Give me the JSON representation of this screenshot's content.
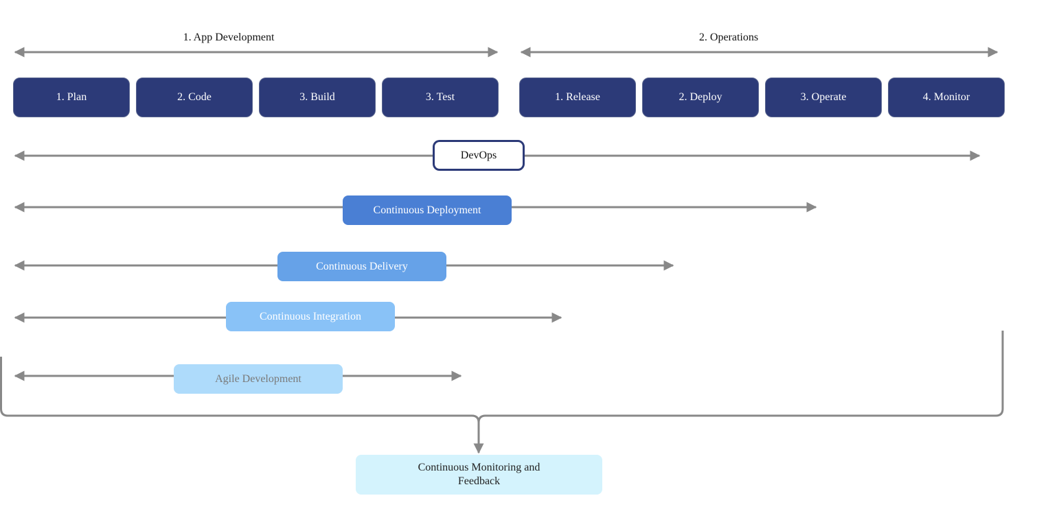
{
  "groups": {
    "app_development": "1. App Development",
    "operations": "2. Operations"
  },
  "phases": [
    {
      "label": "1. Plan"
    },
    {
      "label": "2. Code"
    },
    {
      "label": "3. Build"
    },
    {
      "label": "3. Test"
    },
    {
      "label": "1. Release"
    },
    {
      "label": "2. Deploy"
    },
    {
      "label": "3. Operate"
    },
    {
      "label": "4. Monitor"
    }
  ],
  "practices": {
    "devops": "DevOps",
    "continuous_deployment": "Continuous Deployment",
    "continuous_delivery": "Continuous Delivery",
    "continuous_integration": "Continuous Integration",
    "agile_development": "Agile Development"
  },
  "feedback": {
    "line1": "Continuous Monitoring and",
    "line2": "Feedback"
  },
  "colors": {
    "phase": "#2c3a78",
    "devops_border": "#2c3a78",
    "continuous_deployment": "#4a7fd4",
    "continuous_delivery": "#66a2e8",
    "continuous_integration": "#89c2f7",
    "agile_development": "#aedbfb",
    "feedback": "#d4f3fd",
    "arrow": "#888888"
  }
}
